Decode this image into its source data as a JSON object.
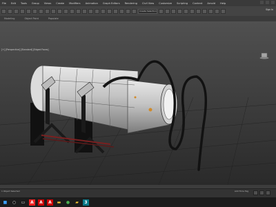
{
  "menubar": {
    "items": [
      "File",
      "Edit",
      "Tools",
      "Group",
      "Views",
      "Create",
      "Modifiers",
      "Animation",
      "Graph Editors",
      "Rendering",
      "Civil View",
      "Customize",
      "Scripting",
      "Content",
      "Arnold",
      "Help"
    ]
  },
  "toolbar": {
    "selection_set": "Create Selection Se",
    "sign_in": "Sign In"
  },
  "ribbon": {
    "tabs": [
      "Modeling",
      "Object Paint",
      "Populate"
    ]
  },
  "viewport": {
    "label": "[+] [Perspective] [Standard] [Edged Faces]"
  },
  "status": {
    "left": "1 Object Selected",
    "right": "Add Time Tag"
  },
  "taskbar": {
    "icons": [
      "windows-start-icon",
      "search-icon",
      "task-view-icon",
      "autodesk-icon",
      "acrobat-icon",
      "acrobat-icon",
      "file-explorer-icon",
      "chrome-icon",
      "folder-icon",
      "3dsmax-icon"
    ]
  }
}
